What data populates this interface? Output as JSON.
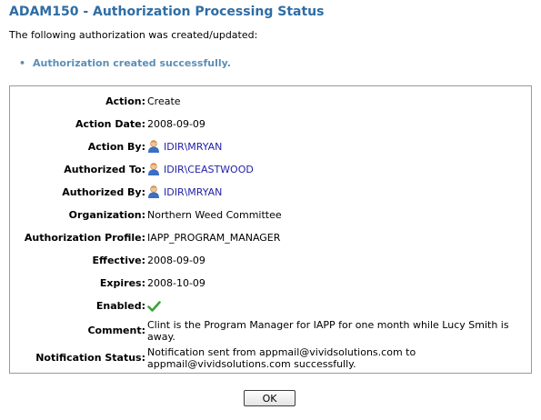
{
  "page": {
    "title": "ADAM150 - Authorization Processing Status",
    "intro": "The following authorization was created/updated:",
    "messages": [
      "Authorization created successfully."
    ],
    "colors": {
      "title": "#2e6da4",
      "message": "#5b8fb8",
      "link": "#1f1fa8",
      "check": "#3aa43a"
    }
  },
  "details": {
    "action": {
      "label": "Action:",
      "value": "Create"
    },
    "action_date": {
      "label": "Action Date:",
      "value": "2008-09-09"
    },
    "action_by": {
      "label": "Action By:",
      "value": "IDIR\\MRYAN",
      "icon": "user-icon"
    },
    "authorized_to": {
      "label": "Authorized To:",
      "value": "IDIR\\CEASTWOOD",
      "icon": "user-icon"
    },
    "authorized_by": {
      "label": "Authorized By:",
      "value": "IDIR\\MRYAN",
      "icon": "user-icon"
    },
    "organization": {
      "label": "Organization:",
      "value": "Northern Weed Committee"
    },
    "profile": {
      "label": "Authorization Profile:",
      "value": "IAPP_PROGRAM_MANAGER"
    },
    "effective": {
      "label": "Effective:",
      "value": "2008-09-09"
    },
    "expires": {
      "label": "Expires:",
      "value": "2008-10-09"
    },
    "enabled": {
      "label": "Enabled:",
      "value": true,
      "icon": "checkmark-icon"
    },
    "comment": {
      "label": "Comment:",
      "value": "Clint is the Program Manager for IAPP for one month while Lucy Smith is away."
    },
    "notification": {
      "label": "Notification Status:",
      "value": "Notification sent from appmail@vividsolutions.com to appmail@vividsolutions.com successfully."
    }
  },
  "buttons": {
    "ok_label": "OK"
  }
}
